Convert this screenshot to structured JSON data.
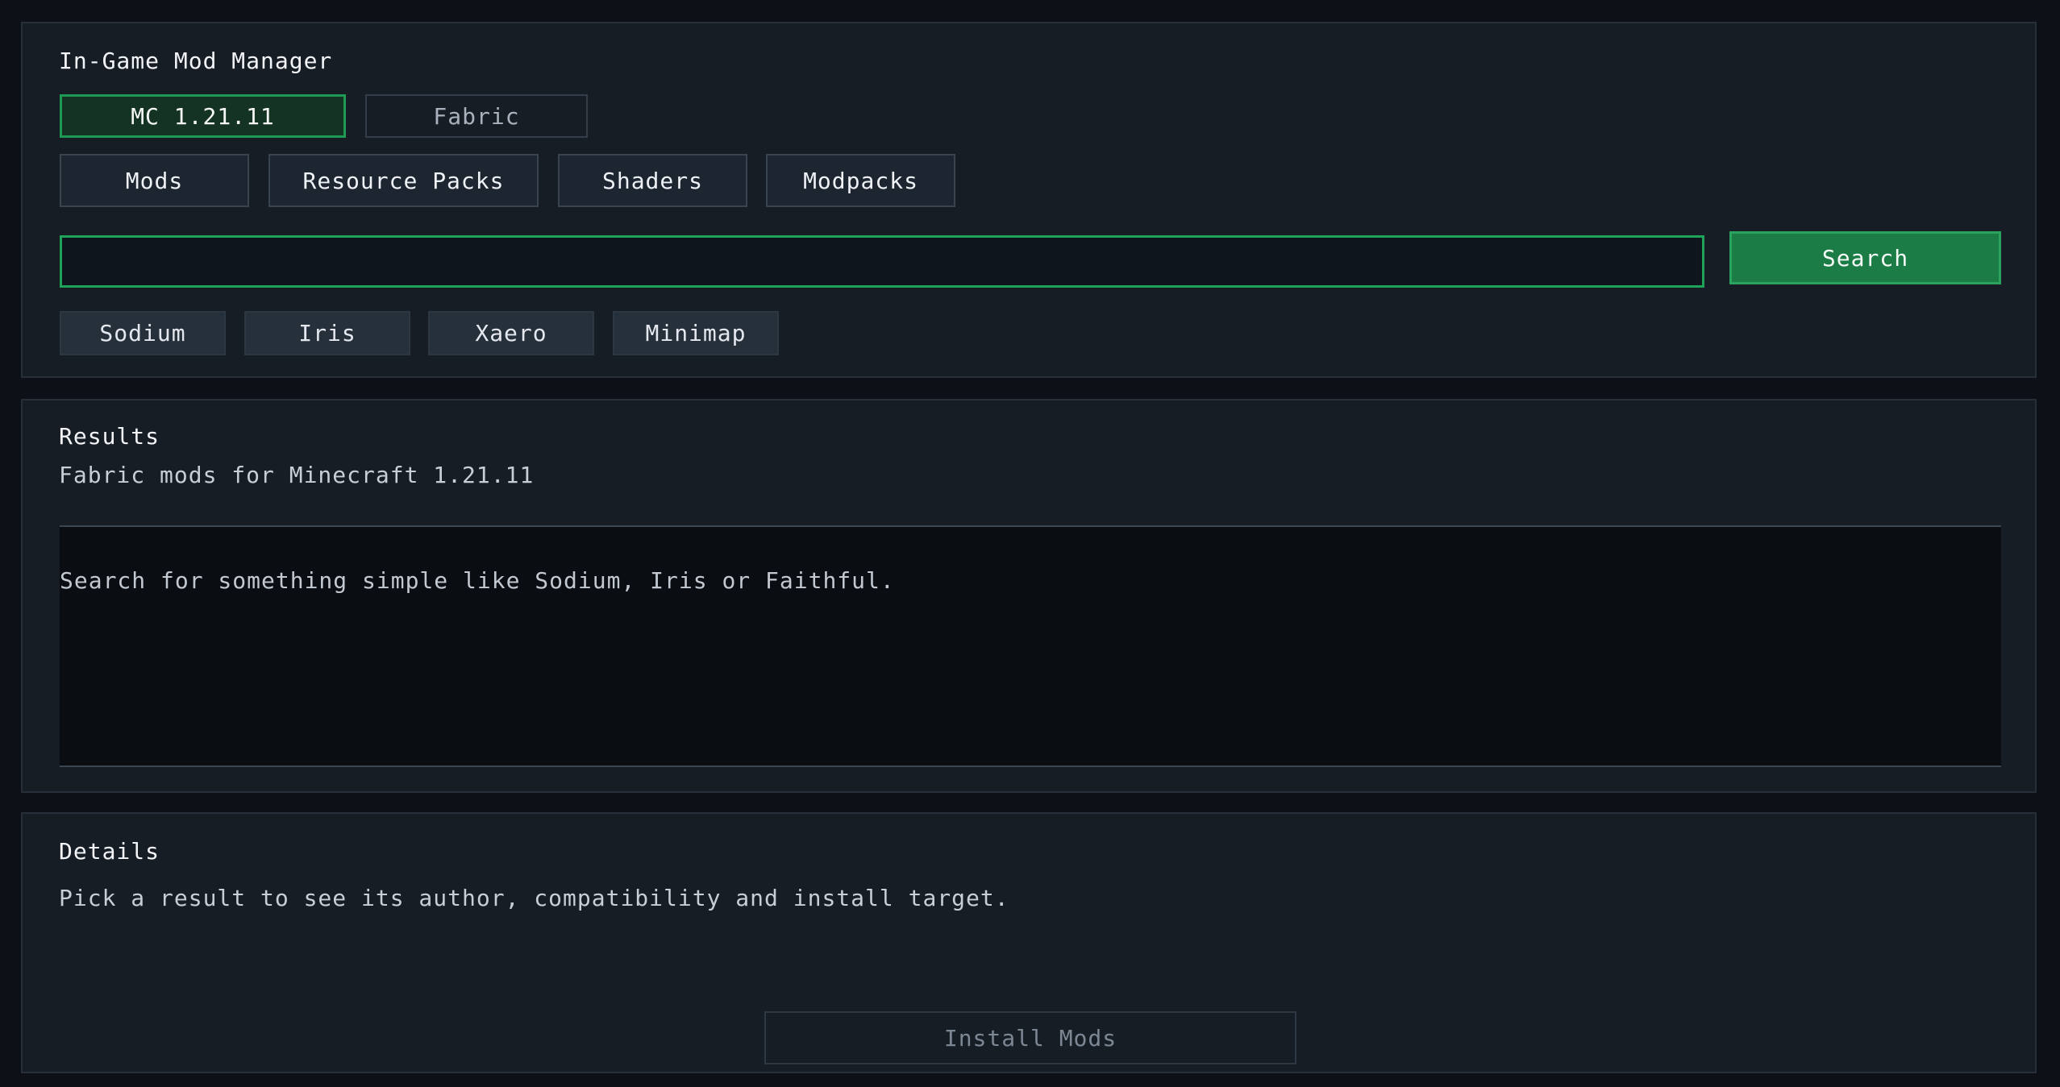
{
  "header": {
    "title": "In-Game Mod Manager"
  },
  "filters": {
    "version_label": "MC 1.21.11",
    "loader_label": "Fabric"
  },
  "categories": [
    {
      "label": "Mods"
    },
    {
      "label": "Resource Packs"
    },
    {
      "label": "Shaders"
    },
    {
      "label": "Modpacks"
    }
  ],
  "search": {
    "value": "",
    "placeholder": "",
    "button_label": "Search"
  },
  "quick_searches": [
    {
      "label": "Sodium"
    },
    {
      "label": "Iris"
    },
    {
      "label": "Xaero"
    },
    {
      "label": "Minimap"
    }
  ],
  "results": {
    "title": "Results",
    "subtitle": "Fabric mods for Minecraft 1.21.11",
    "empty_message": "Search for something simple like Sodium, Iris or Faithful."
  },
  "details": {
    "title": "Details",
    "hint": "Pick a result to see its author, compatibility and install target.",
    "install_label": "Install Mods"
  },
  "colors": {
    "accent": "#1f9a55",
    "background": "#0d1117",
    "panel": "#161d25"
  }
}
